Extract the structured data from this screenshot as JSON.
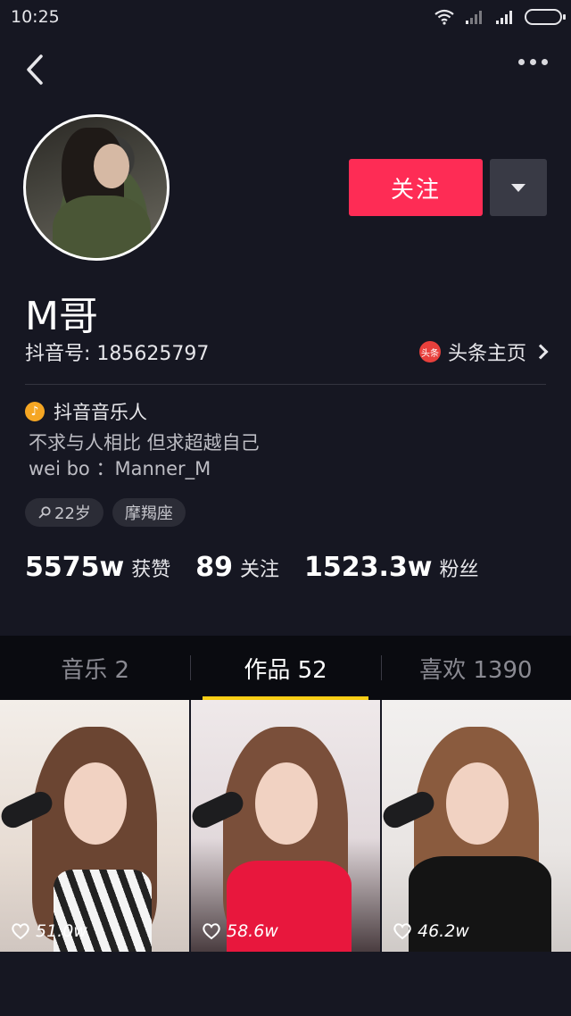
{
  "status_bar": {
    "time": "10:25"
  },
  "profile": {
    "follow_label": "关注",
    "username": "M哥",
    "douyin_id": "抖音号: 185625797",
    "toutiao_label": "头条主页",
    "toutiao_icon_text": "头条",
    "musician_label": "抖音音乐人",
    "bio_line1": "不求与人相比 但求超越自己",
    "bio_line2": "wei bo ：Manner_M",
    "tags": [
      "22岁",
      "摩羯座"
    ],
    "stats": [
      {
        "value": "5575w",
        "label": "获赞"
      },
      {
        "value": "89",
        "label": "关注"
      },
      {
        "value": "1523.3w",
        "label": "粉丝"
      }
    ]
  },
  "tabs": [
    {
      "label": "音乐 2",
      "active": false
    },
    {
      "label": "作品 52",
      "active": true
    },
    {
      "label": "喜欢 1390",
      "active": false
    }
  ],
  "videos": [
    {
      "likes": "51.0w"
    },
    {
      "likes": "58.6w"
    },
    {
      "likes": "46.2w"
    }
  ],
  "colors": {
    "accent": "#fe2c55",
    "tab_underline": "#face15",
    "background": "#161722"
  }
}
